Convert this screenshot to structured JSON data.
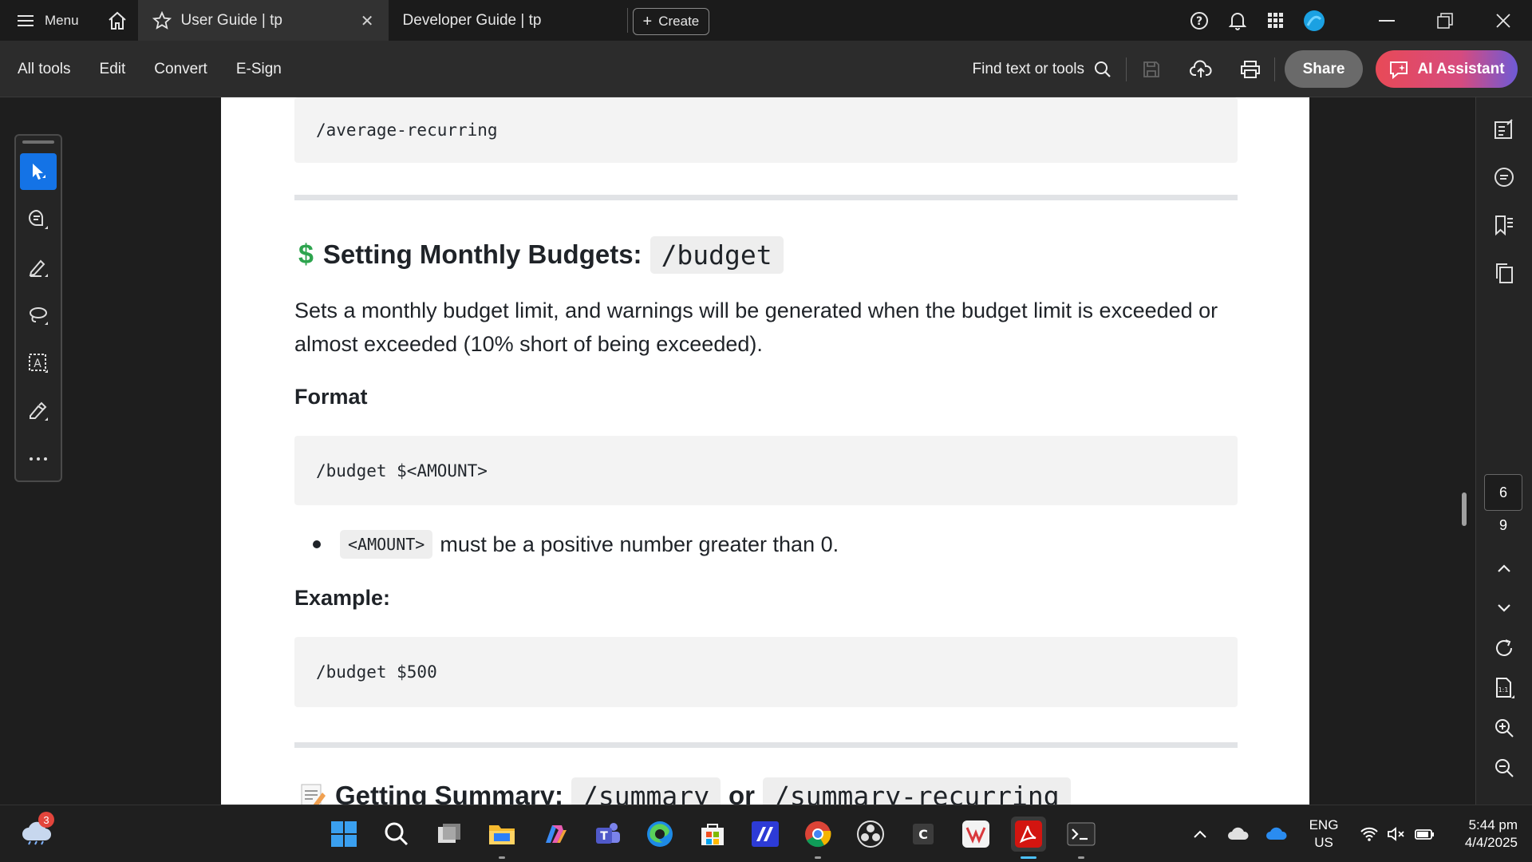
{
  "titlebar": {
    "menu_label": "Menu",
    "tabs": [
      {
        "label": "User Guide | tp",
        "active": true
      },
      {
        "label": "Developer Guide | tp",
        "active": false
      }
    ],
    "create_label": "Create"
  },
  "toolbar": {
    "items": [
      "All tools",
      "Edit",
      "Convert",
      "E-Sign"
    ],
    "find_label": "Find text or tools",
    "share_label": "Share",
    "ai_label": "AI Assistant"
  },
  "document": {
    "code_top": "/average-recurring",
    "section_heading": "Setting Monthly Budgets:",
    "section_command": "/budget",
    "section_icon": "$",
    "description": "Sets a monthly budget limit, and warnings will be generated when the budget limit is exceeded or almost exceeded (10% short of being exceeded).",
    "format_label": "Format",
    "format_code": "/budget $<AMOUNT>",
    "bullet_code": "<AMOUNT>",
    "bullet_text": "must be a positive number greater than 0.",
    "example_label": "Example:",
    "example_code": "/budget $500",
    "next_heading": "Getting Summary:",
    "next_command_1": "/summary",
    "next_or": "or",
    "next_command_2": "/summary-recurring"
  },
  "page_nav": {
    "current": "6",
    "total": "9"
  },
  "taskbar": {
    "weather_badge": "3",
    "lang_line1": "ENG",
    "lang_line2": "US",
    "time": "5:44 pm",
    "date": "4/4/2025"
  },
  "colors": {
    "accent": "#1473e6",
    "ai_button": "#e84a57",
    "dollar_icon": "#2da44e"
  }
}
